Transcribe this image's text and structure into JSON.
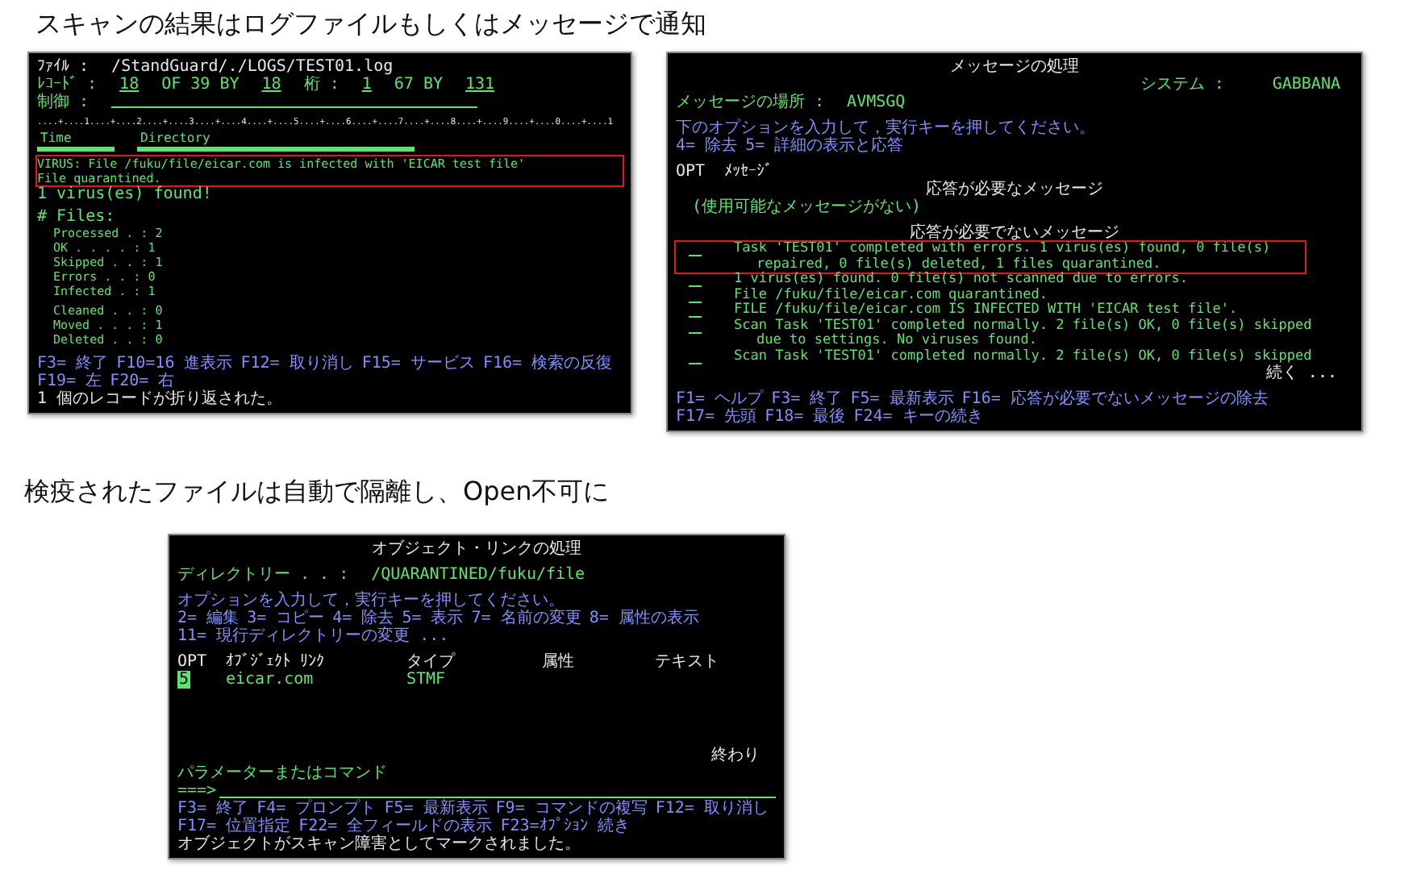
{
  "headings": [
    "スキャンの結果はログファイルもしくはメッセージで通知",
    "検疫されたファイルは自動で隔離し、Open不可に"
  ],
  "screens": [
    {
      "groups": [
        [
          {
            "kind": "segments",
            "segments": [
              {
                "kind": "text",
                "text": "ﾌｧｲﾙ :",
                "color": "#e6e6e6"
              },
              {
                "kind": "text",
                "text": "/StandGuard/./LOGS/TEST01.log",
                "color": "#e6e6e6"
              }
            ]
          },
          {
            "kind": "segments",
            "segments": [
              {
                "kind": "text",
                "text": "ﾚｺｰﾄﾞ :",
                "color": "#5fe36f"
              },
              {
                "kind": "field",
                "text": "18",
                "color": "#5fe36f"
              },
              {
                "kind": "text",
                "text": "OF 39 BY",
                "color": "#5fe36f"
              },
              {
                "kind": "field",
                "text": "18",
                "color": "#5fe36f"
              },
              {
                "kind": "text",
                "text": "桁 :",
                "color": "#5fe36f"
              },
              {
                "kind": "field",
                "text": "1",
                "color": "#5fe36f"
              },
              {
                "kind": "text",
                "text": "67 BY",
                "color": "#5fe36f"
              },
              {
                "kind": "field",
                "text": "131",
                "color": "#5fe36f"
              }
            ]
          },
          {
            "kind": "segments",
            "segments": [
              {
                "kind": "text",
                "text": "制御 :",
                "color": "#5fe36f"
              },
              {
                "kind": "blank_field",
                "color": "#5fe36f"
              }
            ]
          }
        ],
        [
          {
            "kind": "ruler",
            "text": "....+....1....+....2....+....3....+....4....+....5....+....6....+....7....+....8....+....9....+....0....+....1",
            "color": "#e6e6e6"
          },
          {
            "kind": "segments",
            "segments": [
              {
                "kind": "bar_label",
                "text": "Time",
                "color": "#5fe36f"
              },
              {
                "kind": "bar_label",
                "text": "Directory",
                "color": "#5fe36f"
              }
            ]
          }
        ],
        [
          {
            "kind": "block",
            "highlighted": true,
            "color": "#5fe36f",
            "lines": [
              "VIRUS: File /fuku/file/eicar.com is infected with 'EICAR test file'",
              "File quarantined."
            ]
          },
          {
            "kind": "text",
            "text": "1 virus(es) found!",
            "color": "#5fe36f"
          }
        ],
        [
          {
            "kind": "text",
            "text": "# Files:",
            "color": "#5fe36f"
          },
          {
            "kind": "item",
            "text": "Processed . : 2",
            "color": "#5fe36f"
          },
          {
            "kind": "item",
            "text": "OK . . . . : 1",
            "color": "#5fe36f"
          },
          {
            "kind": "item",
            "text": "Skipped . . : 1",
            "color": "#5fe36f"
          },
          {
            "kind": "item",
            "text": "Errors . . : 0",
            "color": "#5fe36f"
          },
          {
            "kind": "item",
            "text": "Infected . : 1",
            "color": "#5fe36f"
          }
        ],
        [
          {
            "kind": "item",
            "text": "Cleaned . . : 0",
            "color": "#5fe36f"
          },
          {
            "kind": "item",
            "text": "Moved . . . : 1",
            "color": "#5fe36f"
          },
          {
            "kind": "item",
            "text": "Deleted . . : 0",
            "color": "#5fe36f"
          }
        ]
      ],
      "footer": [
        {
          "kind": "keys",
          "color": "#8190ff",
          "keys": [
            "F3= 終了",
            "F10=16 進表示",
            "F12= 取り消し",
            "F15= サービス",
            "F16= 検索の反復",
            "F19= 左",
            "F20= 右"
          ]
        },
        {
          "kind": "text",
          "text": "1 個のレコードが折り返された。",
          "color": "#e6e6e6"
        }
      ]
    },
    {
      "groups": [
        [
          {
            "kind": "title",
            "text": "メッセージの処理",
            "color": "#e6e6e6"
          },
          {
            "kind": "segments_end",
            "segments": [
              {
                "kind": "text",
                "text": "システム :",
                "color": "#5fe36f"
              },
              {
                "kind": "text",
                "text": "GABBANA",
                "color": "#5fe36f"
              }
            ]
          },
          {
            "kind": "segments",
            "segments": [
              {
                "kind": "text",
                "text": "メッセージの場所 :",
                "color": "#5fe36f"
              },
              {
                "kind": "text",
                "text": "AVMSGQ",
                "color": "#5fe36f"
              }
            ]
          }
        ],
        [
          {
            "kind": "text",
            "text": "下のオプションを入力して，実行キーを押してください。",
            "color": "#8190ff"
          },
          {
            "kind": "keys",
            "color": "#8190ff",
            "keys": [
              "4= 除去",
              "5= 詳細の表示と応答"
            ]
          }
        ],
        [
          {
            "kind": "columns",
            "color": "#e6e6e6",
            "cells": [
              "OPT",
              "ﾒｯｾｰｼﾞ"
            ]
          },
          {
            "kind": "title",
            "text": "応答が必要なメッセージ",
            "color": "#e6e6e6"
          },
          {
            "kind": "item",
            "text": "(使用可能なメッセージがない)",
            "color": "#5fe36f"
          }
        ],
        [
          {
            "kind": "title",
            "text": "応答が必要でないメッセージ",
            "color": "#e6e6e6"
          },
          {
            "kind": "message",
            "highlighted": true,
            "color": "#5fe36f",
            "lines": [
              "Task 'TEST01' completed with errors. 1 virus(es) found, 0 file(s)",
              "repaired, 0 file(s) deleted, 1 files quarantined."
            ]
          },
          {
            "kind": "message",
            "highlighted": false,
            "color": "#5fe36f",
            "lines": [
              "1 virus(es) found. 0 file(s) not scanned due to errors."
            ]
          },
          {
            "kind": "message",
            "highlighted": false,
            "color": "#5fe36f",
            "lines": [
              "File /fuku/file/eicar.com quarantined."
            ]
          },
          {
            "kind": "message",
            "highlighted": false,
            "color": "#5fe36f",
            "lines": [
              "FILE /fuku/file/eicar.com IS INFECTED WITH 'EICAR test file'."
            ]
          },
          {
            "kind": "message",
            "highlighted": false,
            "color": "#5fe36f",
            "lines": [
              "Scan Task 'TEST01' completed normally. 2 file(s) OK, 0 file(s) skipped",
              "due to settings. No viruses found."
            ]
          },
          {
            "kind": "message",
            "highlighted": false,
            "color": "#5fe36f",
            "lines": [
              "Scan Task 'TEST01' completed normally. 2 file(s) OK, 0 file(s) skipped"
            ]
          },
          {
            "kind": "trailer",
            "text": "続く ...",
            "color": "#e6e6e6"
          }
        ]
      ],
      "footer": [
        {
          "kind": "keys",
          "color": "#8190ff",
          "keys": [
            "F1= ヘルプ",
            "F3= 終了",
            "F5= 最新表示",
            "F16= 応答が必要でないメッセージの除去"
          ]
        },
        {
          "kind": "keys",
          "color": "#8190ff",
          "keys": [
            "F17= 先頭",
            "F18= 最後",
            "F24= キーの続き"
          ]
        }
      ]
    },
    {
      "groups": [
        [
          {
            "kind": "title",
            "text": "オブジェクト・リンクの処理",
            "color": "#e6e6e6"
          }
        ],
        [
          {
            "kind": "segments",
            "segments": [
              {
                "kind": "text",
                "text": "ディレクトリー . . :",
                "color": "#5fe36f"
              },
              {
                "kind": "text",
                "text": "/QUARANTINED/fuku/file",
                "color": "#5fe36f"
              }
            ]
          }
        ],
        [
          {
            "kind": "text",
            "text": "オプションを入力して，実行キーを押してください。",
            "color": "#8190ff"
          },
          {
            "kind": "keys",
            "color": "#8190ff",
            "keys": [
              "2= 編集",
              "3= コピー",
              "4= 除去",
              "5= 表示",
              "7= 名前の変更",
              "8= 属性の表示"
            ]
          },
          {
            "kind": "keys",
            "color": "#8190ff",
            "keys": [
              "11= 現行ディレクトリーの変更 ..."
            ]
          }
        ],
        [
          {
            "kind": "columns",
            "color": "#e6e6e6",
            "cells": [
              "OPT",
              "ｵﾌﾞｼﾞｪｸﾄ ﾘﾝｸ",
              "タイプ",
              "属性",
              "テキスト"
            ]
          },
          {
            "kind": "entry",
            "color": "#5fe36f",
            "opt": "5",
            "cells": [
              "eicar.com",
              "STMF"
            ]
          }
        ]
      ],
      "footer": [
        {
          "kind": "trailer",
          "text": "終わり",
          "color": "#e6e6e6"
        },
        {
          "kind": "text",
          "text": "パラメーターまたはコマンド",
          "color": "#5fe36f"
        },
        {
          "kind": "command",
          "prompt": "===>",
          "color": "#5fe36f"
        },
        {
          "kind": "keys",
          "color": "#8190ff",
          "keys": [
            "F3= 終了",
            "F4= プロンプト",
            "F5= 最新表示",
            "F9= コマンドの複写",
            "F12= 取り消し"
          ]
        },
        {
          "kind": "keys",
          "color": "#8190ff",
          "keys": [
            "F17= 位置指定",
            "F22= 全フィールドの表示",
            "F23=ｵﾌﾟｼｮﾝ 続き"
          ]
        },
        {
          "kind": "text",
          "text": "オブジェクトがスキャン障害としてマークされました。",
          "color": "#e6e6e6"
        }
      ]
    }
  ]
}
